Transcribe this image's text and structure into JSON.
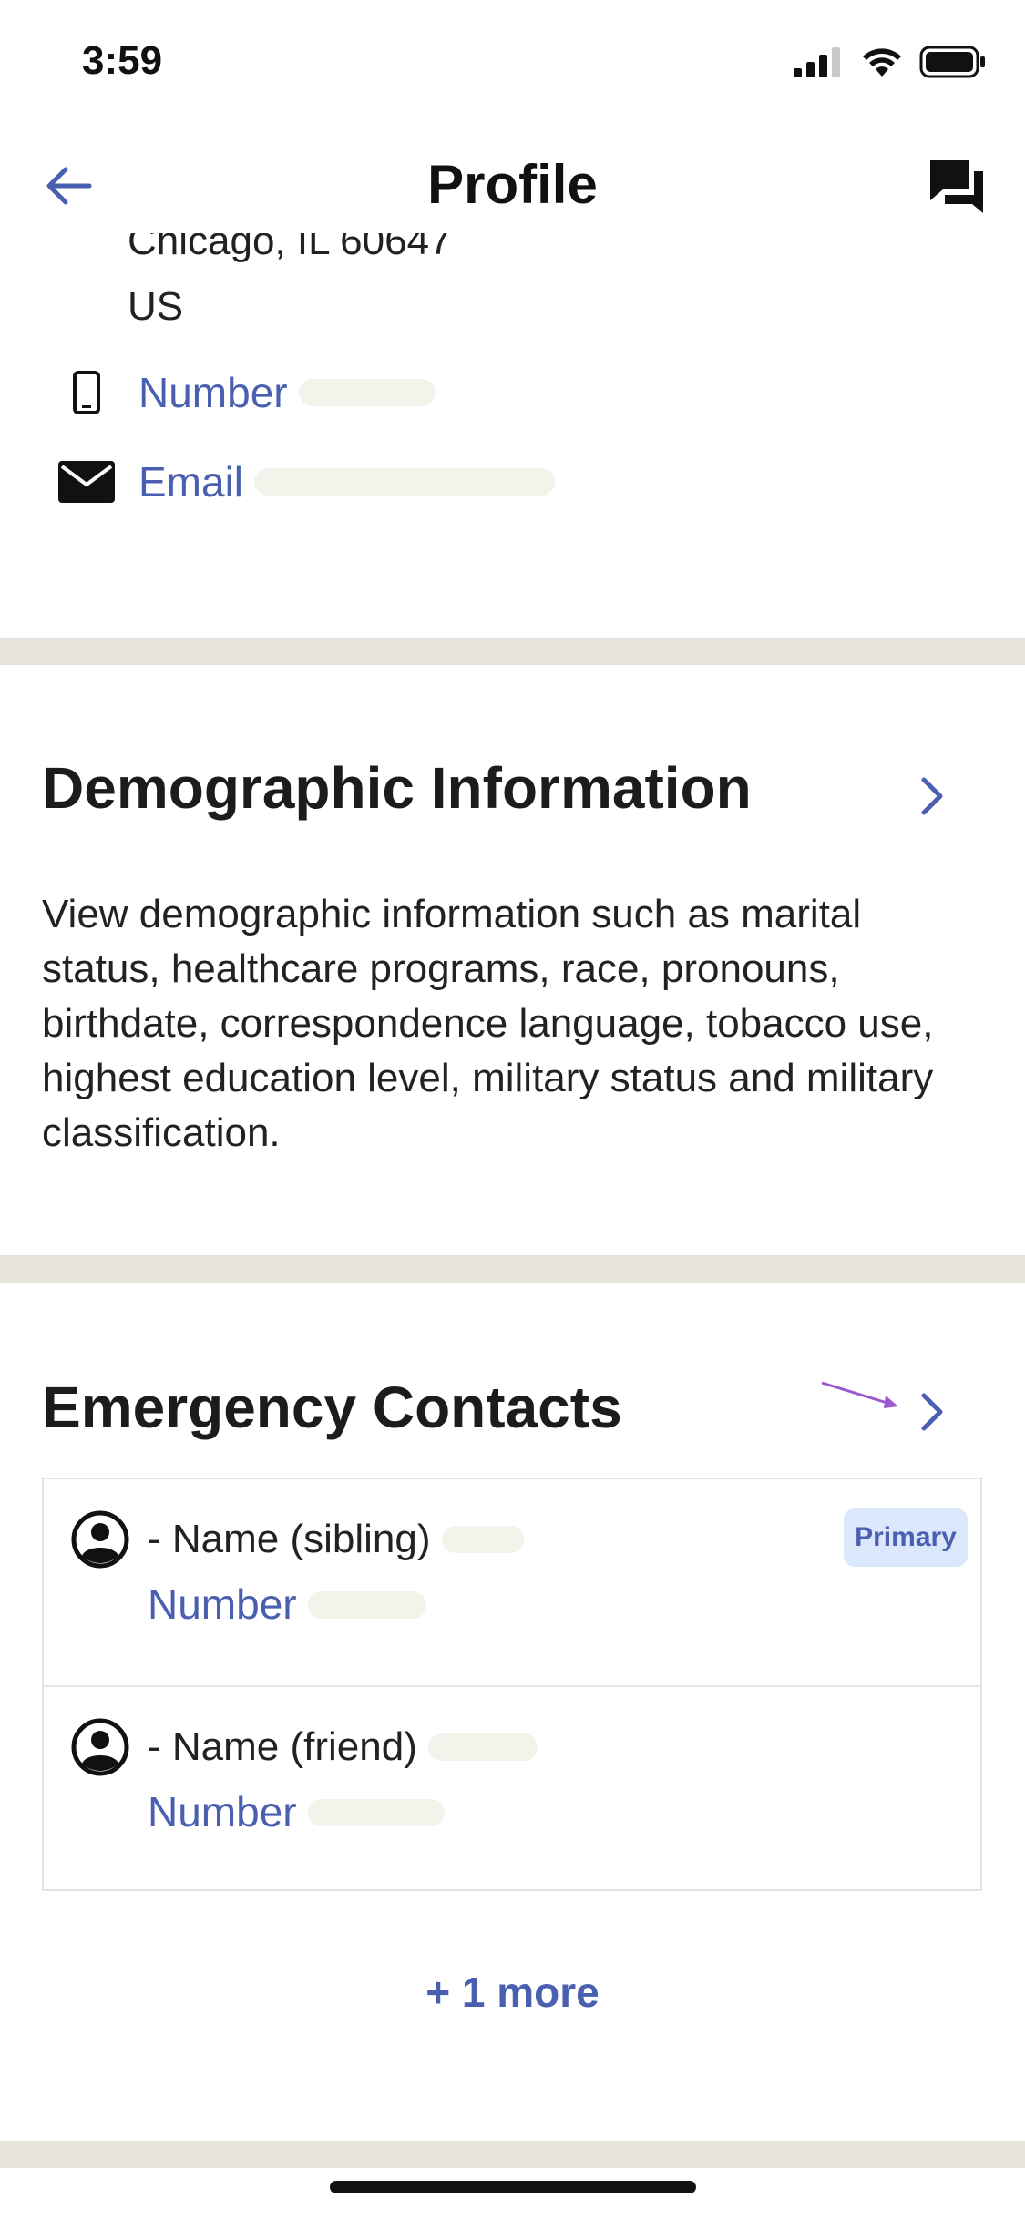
{
  "status_bar": {
    "time": "3:59"
  },
  "nav": {
    "title": "Profile"
  },
  "address": {
    "line1": "Chicago, IL 60647",
    "line2": "US"
  },
  "contact": {
    "phone_label": "Number",
    "email_label": "Email"
  },
  "demographic": {
    "title": "Demographic Information",
    "description": "View demographic information such as marital status, healthcare programs, race, pronouns, birthdate, correspondence language, tobacco use, highest education level, military status and military classification."
  },
  "emergency": {
    "title": "Emergency Contacts",
    "contacts": [
      {
        "name": "- Name (sibling)",
        "number_label": "Number",
        "badge": "Primary"
      },
      {
        "name": "- Name (friend)",
        "number_label": "Number"
      }
    ],
    "more_label": "+ 1 more"
  },
  "colors": {
    "link": "#4a5fb0",
    "divider": "#e6e2dc",
    "badge_bg": "#dbe8fb",
    "annotation_arrow": "#9b59d0"
  }
}
